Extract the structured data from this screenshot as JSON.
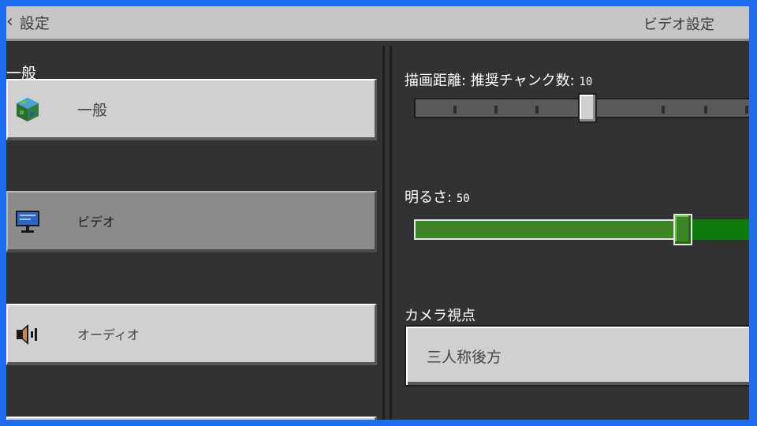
{
  "header": {
    "back_label": "設定",
    "title": "ビデオ設定"
  },
  "sidebar": {
    "section_label": "一般",
    "items": [
      {
        "label": "一般",
        "icon": "globe-icon",
        "selected": false
      },
      {
        "label": "ビデオ",
        "icon": "monitor-icon",
        "selected": true
      },
      {
        "label": "オーディオ",
        "icon": "speaker-icon",
        "selected": false
      }
    ]
  },
  "settings": {
    "render_distance": {
      "label": "描画距離: 推奨チャンク数:",
      "value": "10",
      "fraction": 0.5
    },
    "brightness": {
      "label": "明るさ:",
      "value": "50",
      "fraction": 0.775
    },
    "camera": {
      "label": "カメラ視点",
      "value": "三人称後方"
    }
  },
  "colors": {
    "accent_green": "#3c8527",
    "frame_blue": "#1e6cf0",
    "panel_dark": "#313233",
    "button_gray": "#d0d0d0"
  }
}
